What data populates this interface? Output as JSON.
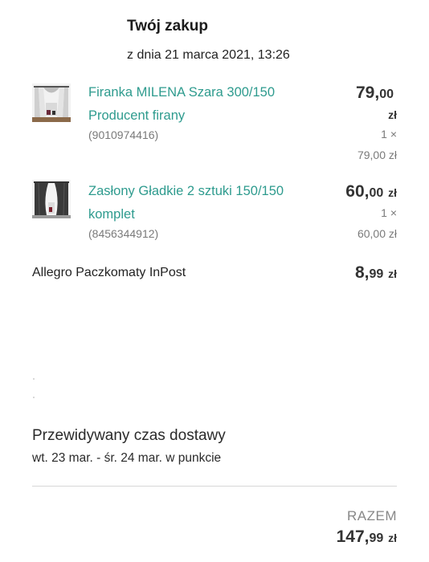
{
  "header": {
    "title": "Twój zakup",
    "date": "z dnia 21 marca 2021, 13:26"
  },
  "items": [
    {
      "name_line1": "Firanka MILENA Szara 300/150",
      "name_line2": "Producent firany",
      "code": "(9010974416)",
      "price_int": "79,",
      "price_dec": "00",
      "currency": "zł",
      "qty": "1 ×",
      "unit_price": "79,00 zł",
      "thumb_icon": "sheer-curtain-icon"
    },
    {
      "name_line1": "Zasłony Gładkie 2 sztuki 150/150",
      "name_line2": "komplet",
      "code": "(8456344912)",
      "price_int": "60,",
      "price_dec": "00",
      "currency": "zł",
      "qty": "1 ×",
      "unit_price": "60,00 zł",
      "thumb_icon": "dark-curtain-icon"
    }
  ],
  "shipping": {
    "label": "Allegro Paczkomaty InPost",
    "price_int": "8,",
    "price_dec": "99",
    "currency": "zł"
  },
  "delivery": {
    "label": "Przewidywany czas dostawy",
    "range": "wt. 23 mar. - śr. 24 mar. w punkcie"
  },
  "total": {
    "label": "RAZEM",
    "value_int": "147,",
    "value_dec": "99",
    "currency": "zł"
  },
  "colors": {
    "product_link": "#2e9b8e",
    "muted": "#7a7a7a",
    "price": "#333333"
  }
}
